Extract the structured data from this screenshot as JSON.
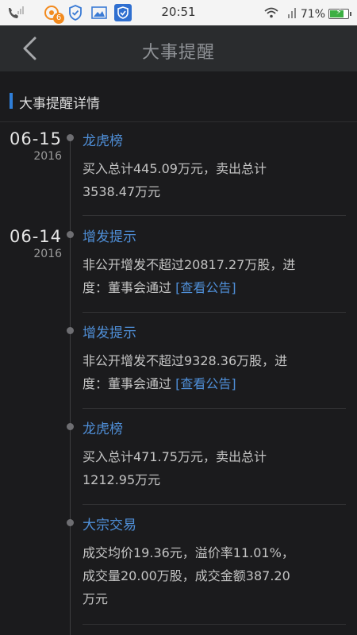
{
  "status_bar": {
    "time": "20:51",
    "battery_text": "71%",
    "battery_level": 0.71,
    "notification_badge": "6",
    "icons": [
      "phone-signal-icon",
      "app-notification-icon",
      "shield-check-icon",
      "image-icon",
      "security-shield-icon",
      "wifi-icon",
      "signal-icon",
      "battery-icon"
    ]
  },
  "header": {
    "title": "大事提醒",
    "back_icon": "chevron-left-icon"
  },
  "section": {
    "title": "大事提醒详情",
    "accent_color": "#2f7ed8"
  },
  "groups": [
    {
      "date": "06-15",
      "year": "2016",
      "events": [
        {
          "title": "龙虎榜",
          "lines": [
            "买入总计445.09万元，卖出总计",
            "3538.47万元"
          ],
          "link": ""
        }
      ]
    },
    {
      "date": "06-14",
      "year": "2016",
      "events": [
        {
          "title": "增发提示",
          "lines": [
            "非公开增发不超过20817.27万股，进",
            "度：董事会通过 "
          ],
          "link": "[查看公告]"
        },
        {
          "title": "增发提示",
          "lines": [
            "非公开增发不超过9328.36万股，进",
            "度：董事会通过 "
          ],
          "link": "[查看公告]"
        },
        {
          "title": "龙虎榜",
          "lines": [
            "买入总计471.75万元，卖出总计",
            "1212.95万元"
          ],
          "link": ""
        },
        {
          "title": "大宗交易",
          "lines": [
            "成交均价19.36元，溢价率11.01%，",
            "成交量20.00万股，成交金额387.20",
            "万元"
          ],
          "link": ""
        }
      ]
    }
  ]
}
